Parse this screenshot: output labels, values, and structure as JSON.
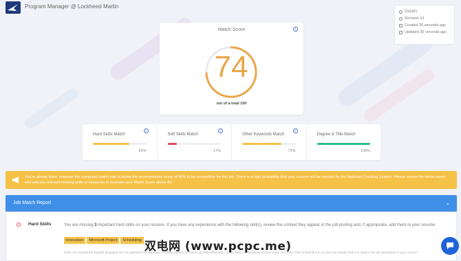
{
  "header": {
    "title": "Program Manager @ Lockheed Martin"
  },
  "details": {
    "title": "Details",
    "revision": "Revision #1",
    "created": "Created 30 seconds ago",
    "updated": "Updated 30 seconds ago"
  },
  "score": {
    "label": "Match Score",
    "value": "74",
    "value_fraction": 0.74,
    "total": "out of a total 100"
  },
  "metrics": [
    {
      "label": "Hard Skills Match",
      "pct": "69%",
      "value": 0.69,
      "color": "#f5c147"
    },
    {
      "label": "Soft Skills Match",
      "pct": "17%",
      "value": 0.17,
      "color": "#e34a5a"
    },
    {
      "label": "Other Keywords Match",
      "pct": "73%",
      "value": 0.73,
      "color": "#f5c147"
    },
    {
      "label": "Degree & Title Match",
      "pct": "100%",
      "value": 1.0,
      "color": "#2bbd8e"
    }
  ],
  "alert": {
    "text": "You're almost there, however the computed match rate is below the recommended score of 80% to be competitive for this job. There is a high probability that your resume will be rejected by the Applicant Tracking System. Please review the below report and add any relevant missing skills or keywords to increase your Match Score above 80."
  },
  "report": {
    "title": "Job Match Report",
    "hard_skills": {
      "title": "Hard Skills",
      "text_pre": "You are missing",
      "count": "3",
      "text_post": "important hard skills on your resume. If you have any experience with the following skill(s), review the context they appear in the job posting and, if appropriate, add them to your resume.",
      "tags": [
        "Innovation",
        "Microsoft Project",
        "Scheduling"
      ],
      "note": "Note: You missed the English language are not optimized for Applicant Tracking System to match job skills effectively; for the best results please review some of a word. Role of thumb is to try and use exactly how it is used in the job description in your resume."
    }
  },
  "watermark": "双电网 (www.pcpc.me)",
  "colors": {
    "accent": "#3f8fe9",
    "score": "#e8a84a",
    "alert": "#f5c147",
    "danger": "#e34a5a",
    "success": "#2bbd8e"
  }
}
